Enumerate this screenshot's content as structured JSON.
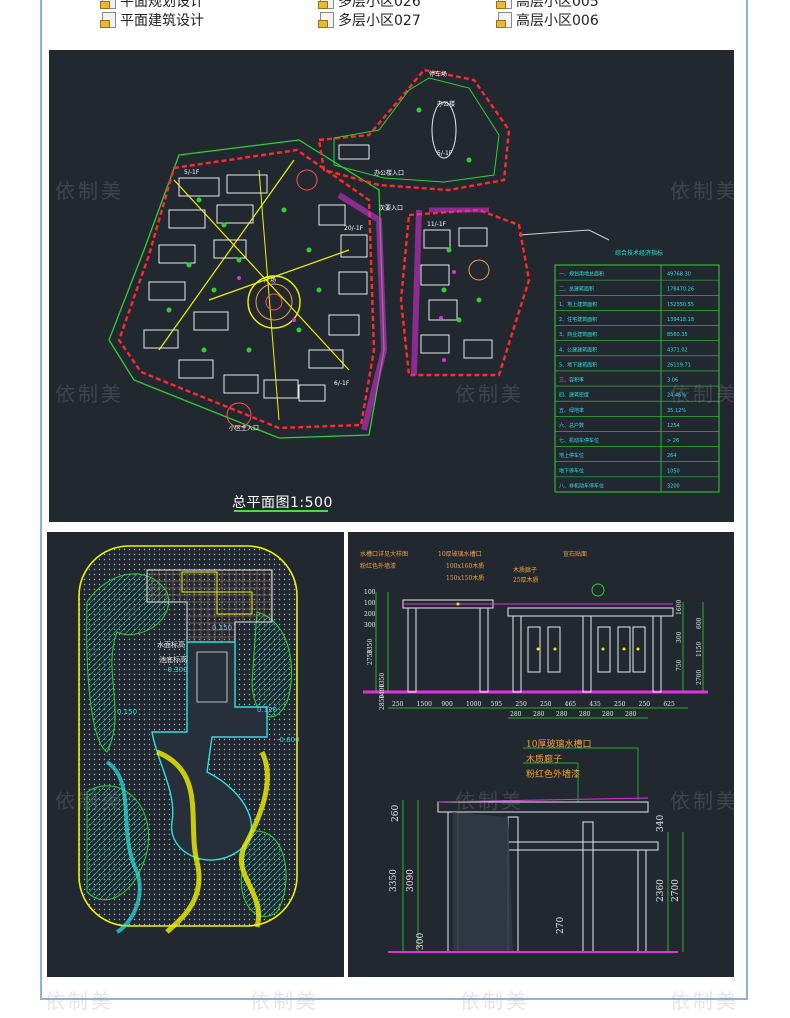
{
  "files": [
    {
      "name": "平面规划设计"
    },
    {
      "name": "多层小区026"
    },
    {
      "name": "高层小区005"
    },
    {
      "name": "平面建筑设计"
    },
    {
      "name": "多层小区027"
    },
    {
      "name": "高层小区006"
    }
  ],
  "plan": {
    "caption": "总平面图1:500",
    "labels": {
      "car_park": "停车场",
      "office": "办公楼",
      "office_floors": "5/-1F",
      "entrance_office": "办公楼入口",
      "entrance_south": "小区主入口",
      "entrance_side": "次要入口",
      "plaza": "广场",
      "bldg_a": "5/-1F",
      "bldg_b": "6/-1F",
      "bldg_c": "11/-1F",
      "bldg_d": "20/-1F"
    },
    "table": {
      "title": "综合技术经济指标",
      "rows": [
        {
          "label": "一、规划用地总面积",
          "value": "49768.30"
        },
        {
          "label": "二、总建筑面积",
          "value": "178470.26"
        },
        {
          "label": "1、地上建筑面积",
          "value": "152350.55"
        },
        {
          "label": "2、住宅建筑面积",
          "value": "139418.18"
        },
        {
          "label": "3、商业建筑面积",
          "value": "8560.35"
        },
        {
          "label": "4、公建建筑面积",
          "value": "4371.02"
        },
        {
          "label": "5、地下建筑面积",
          "value": "26119.71"
        },
        {
          "label": "三、容积率",
          "value": "3.06"
        },
        {
          "label": "四、建筑密度",
          "value": "24.46%"
        },
        {
          "label": "五、绿地率",
          "value": "35.12%"
        },
        {
          "label": "六、总户数",
          "value": "1254"
        },
        {
          "label": "七、机动车停车位",
          "value": "> 26"
        },
        {
          "label": "地上停车位",
          "value": "264"
        },
        {
          "label": "地下停车位",
          "value": "1050"
        },
        {
          "label": "八、非机动车停车位",
          "value": "3200"
        }
      ]
    }
  },
  "garden": {
    "labels": {
      "water_level": "水面标高",
      "pool_bottom": "池底标高",
      "elev_a": "0.150",
      "elev_b": "-0.300",
      "elev_c": "-0.600",
      "elev_d": "0.120",
      "elev_e": "0.150"
    }
  },
  "elevation": {
    "top_notes": [
      "水槽口详见大样图",
      "10厚玻璃水槽口",
      "木质廊子",
      "宣石贴面"
    ],
    "top_notes2": [
      "粉红色外墙漆",
      "100x160木质",
      "150x150木质",
      "25厚木质"
    ],
    "dims_top": [
      "250",
      "1500",
      "900",
      "1000",
      "595",
      "250",
      "250",
      "465",
      "435",
      "250",
      "250",
      "625"
    ],
    "dims_top2": [
      "280",
      "280",
      "280",
      "280",
      "280",
      "280"
    ],
    "dims_left": [
      "100",
      "100",
      "200",
      "300",
      "3350",
      "2750",
      "1350",
      "1400",
      "2850"
    ],
    "dims_right": [
      "1600",
      "600",
      "300",
      "1150",
      "750",
      "2700"
    ],
    "section_notes": [
      "10厚玻璃水槽口",
      "木质廊子",
      "粉红色外墙漆"
    ],
    "section_dims": [
      "260",
      "3350",
      "3090",
      "340",
      "2360",
      "2700",
      "270",
      "300"
    ]
  },
  "watermark": "依制美",
  "colors": {
    "panel_bg": "#222830",
    "red": "#ff2a2a",
    "yellow": "#f2f200",
    "green": "#30d030",
    "cyan": "#30e0e0",
    "magenta": "#e030e0",
    "white": "#ffffff",
    "frame": "#8fb0dc"
  }
}
